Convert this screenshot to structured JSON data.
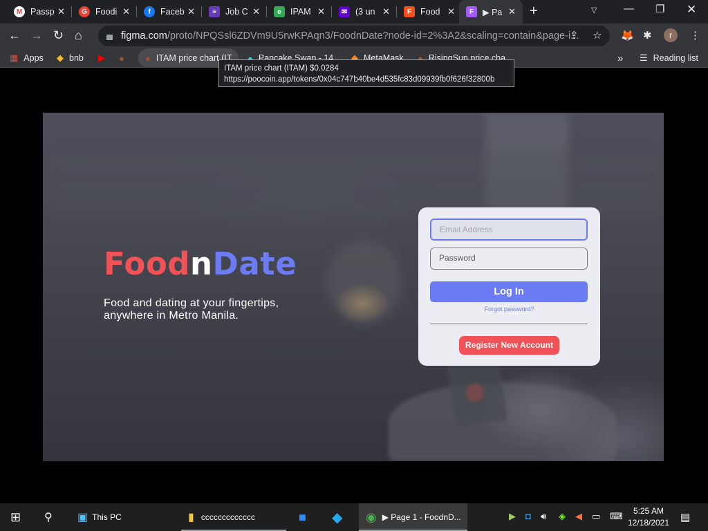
{
  "browser": {
    "tabs": [
      {
        "title": "Passp",
        "icon": "M",
        "color": "#ea4335",
        "iconbg": "#ffffff"
      },
      {
        "title": "Foodi",
        "icon": "G",
        "color": "#ffffff",
        "iconbg": "#ea4335"
      },
      {
        "title": "Faceb",
        "icon": "f",
        "color": "#ffffff",
        "iconbg": "#1877f2"
      },
      {
        "title": "Job C",
        "icon": "≡",
        "color": "#ffffff",
        "iconbg": "#673ab7"
      },
      {
        "title": "IPAM",
        "icon": "e",
        "color": "#ffffff",
        "iconbg": "#34a853"
      },
      {
        "title": "(3 un",
        "icon": "✉",
        "color": "#ffffff",
        "iconbg": "#6001d2"
      },
      {
        "title": "Food",
        "icon": "F",
        "color": "#ffffff",
        "iconbg": "#f24e1e"
      },
      {
        "title": "▶ Pa",
        "icon": "F",
        "color": "#ffffff",
        "iconbg": "#a259ff"
      }
    ],
    "close_glyph": "✕",
    "new_tab": "+",
    "url_domain": "figma.com",
    "url_path": "/proto/NPQSsl6ZDVm9U5rwKPAqn3/FoodnDate?node-id=2%3A2&scaling=contain&page-i...",
    "bookmarks": {
      "apps": "Apps",
      "bnb": "bnb",
      "itam": "ITAM price chart (IT",
      "pancake": "Pancake Swap - 14...",
      "metamask": "MetaMask",
      "risingsun": "RisingSun price cha...",
      "more": "»",
      "reading_list": "Reading list"
    },
    "tooltip": {
      "line1": "ITAM price chart (ITAM) $0.0284",
      "line2": "https://poocoin.app/tokens/0x04c747b40be4d535fc83d09939fb0f626f32800b"
    },
    "avatar_letter": "r"
  },
  "app": {
    "brand_food": "Food",
    "brand_n": "n",
    "brand_date": "Date",
    "tagline_line1": "Food and dating at your fingertips,",
    "tagline_line2": "anywhere in Metro Manila.",
    "email_placeholder": "Email Address",
    "password_placeholder": "Password",
    "login_label": "Log In",
    "forgot_label": "Forgot password?",
    "register_label": "Register New Account",
    "colors": {
      "red": "#f05257",
      "white": "#ffffff",
      "blue": "#6b7cf5"
    }
  },
  "taskbar": {
    "this_pc": "This PC",
    "folder": "ccccccccccccc",
    "chrome": "▶ Page 1 - FoodnD...",
    "time": "5:25 AM",
    "date": "12/18/2021"
  }
}
